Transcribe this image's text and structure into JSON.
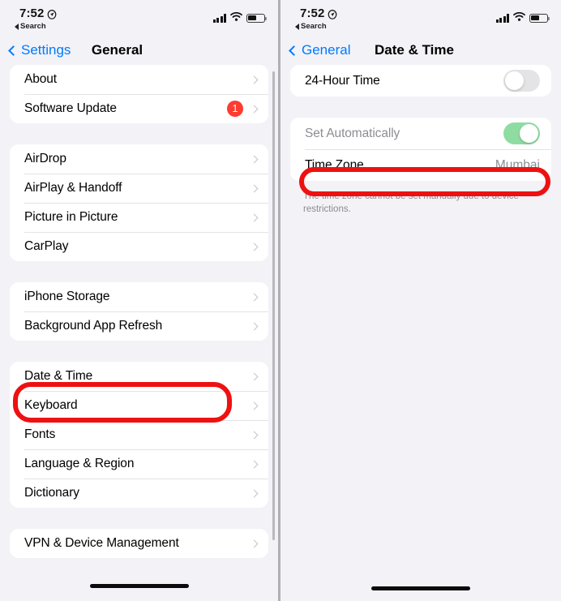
{
  "left": {
    "status_bar": {
      "time": "7:52",
      "location_icon": "location-arrow-icon",
      "back_app": "Search",
      "signal_icon": "cellular-signal-icon",
      "wifi_icon": "wifi-icon",
      "battery_icon": "battery-icon"
    },
    "nav": {
      "back_label": "Settings",
      "title": "General"
    },
    "groups": [
      {
        "rows": [
          {
            "label": "About",
            "chevron": true
          },
          {
            "label": "Software Update",
            "badge": "1",
            "chevron": true
          }
        ]
      },
      {
        "rows": [
          {
            "label": "AirDrop",
            "chevron": true
          },
          {
            "label": "AirPlay & Handoff",
            "chevron": true
          },
          {
            "label": "Picture in Picture",
            "chevron": true
          },
          {
            "label": "CarPlay",
            "chevron": true
          }
        ]
      },
      {
        "rows": [
          {
            "label": "iPhone Storage",
            "chevron": true
          },
          {
            "label": "Background App Refresh",
            "chevron": true
          }
        ]
      },
      {
        "rows": [
          {
            "label": "Date & Time",
            "chevron": true
          },
          {
            "label": "Keyboard",
            "chevron": true
          },
          {
            "label": "Fonts",
            "chevron": true
          },
          {
            "label": "Language & Region",
            "chevron": true
          },
          {
            "label": "Dictionary",
            "chevron": true
          }
        ]
      },
      {
        "rows": [
          {
            "label": "VPN & Device Management",
            "chevron": true
          }
        ]
      }
    ],
    "highlight": {
      "target": "Date & Time",
      "color": "#ee1111"
    }
  },
  "right": {
    "status_bar": {
      "time": "7:52",
      "location_icon": "location-arrow-icon",
      "back_app": "Search",
      "signal_icon": "cellular-signal-icon",
      "wifi_icon": "wifi-icon",
      "battery_icon": "battery-icon"
    },
    "nav": {
      "back_label": "General",
      "title": "Date & Time"
    },
    "group_one": {
      "rows": [
        {
          "label": "24-Hour Time",
          "toggle": "off"
        }
      ]
    },
    "group_two": {
      "rows": [
        {
          "label": "Set Automatically",
          "toggle": "on",
          "disabled": true
        },
        {
          "label": "Time Zone",
          "value": "Mumbai"
        }
      ]
    },
    "caption": "The time zone cannot be set manually due to device restrictions.",
    "highlight": {
      "target": "Time Zone",
      "color": "#ee1111"
    }
  },
  "colors": {
    "accent": "#007aff",
    "badge": "#ff3b30",
    "toggle_on": "#34c759",
    "toggle_on_disabled": "#8fdca3",
    "highlight": "#ee1111",
    "background": "#f2f2f7",
    "card": "#ffffff",
    "secondary_text": "#8e8e93"
  }
}
